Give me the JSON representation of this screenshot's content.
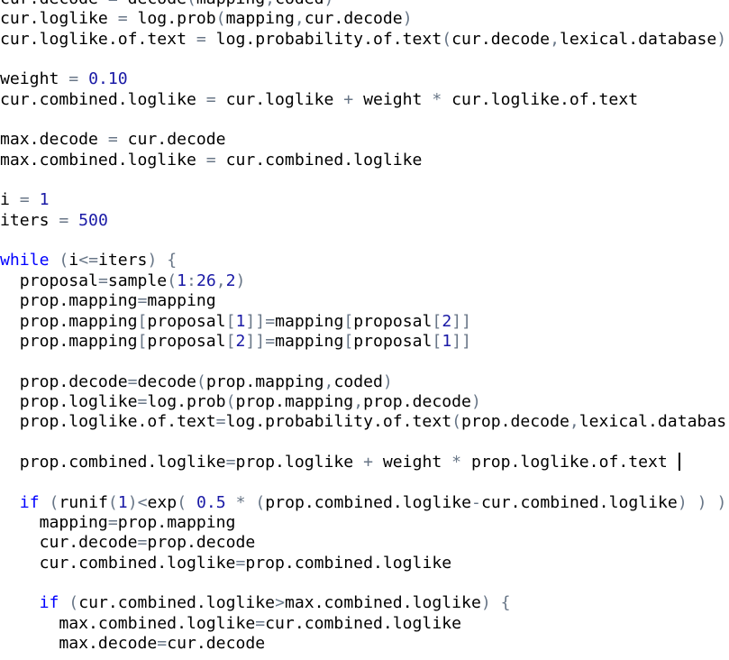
{
  "editor": {
    "cursor_line": 23,
    "lines": [
      [
        {
          "t": "cur.decode",
          "k": "id"
        },
        {
          "t": " = ",
          "k": "op"
        },
        {
          "t": "decode",
          "k": "id"
        },
        {
          "t": "(",
          "k": "br"
        },
        {
          "t": "mapping",
          "k": "id"
        },
        {
          "t": ",",
          "k": "op"
        },
        {
          "t": "coded",
          "k": "id"
        },
        {
          "t": ")",
          "k": "br"
        }
      ],
      [
        {
          "t": "cur.loglike",
          "k": "id"
        },
        {
          "t": " = ",
          "k": "op"
        },
        {
          "t": "log.prob",
          "k": "id"
        },
        {
          "t": "(",
          "k": "br"
        },
        {
          "t": "mapping",
          "k": "id"
        },
        {
          "t": ",",
          "k": "op"
        },
        {
          "t": "cur.decode",
          "k": "id"
        },
        {
          "t": ")",
          "k": "br"
        }
      ],
      [
        {
          "t": "cur.loglike.of.text",
          "k": "id"
        },
        {
          "t": " = ",
          "k": "op"
        },
        {
          "t": "log.probability.of.text",
          "k": "id"
        },
        {
          "t": "(",
          "k": "br"
        },
        {
          "t": "cur.decode",
          "k": "id"
        },
        {
          "t": ",",
          "k": "op"
        },
        {
          "t": "lexical.database",
          "k": "id"
        },
        {
          "t": ")",
          "k": "br"
        }
      ],
      [],
      [
        {
          "t": "weight",
          "k": "id"
        },
        {
          "t": " = ",
          "k": "op"
        },
        {
          "t": "0.10",
          "k": "num"
        }
      ],
      [
        {
          "t": "cur.combined.loglike",
          "k": "id"
        },
        {
          "t": " = ",
          "k": "op"
        },
        {
          "t": "cur.loglike",
          "k": "id"
        },
        {
          "t": " + ",
          "k": "op"
        },
        {
          "t": "weight",
          "k": "id"
        },
        {
          "t": " * ",
          "k": "op"
        },
        {
          "t": "cur.loglike.of.text",
          "k": "id"
        }
      ],
      [],
      [
        {
          "t": "max.decode",
          "k": "id"
        },
        {
          "t": " = ",
          "k": "op"
        },
        {
          "t": "cur.decode",
          "k": "id"
        }
      ],
      [
        {
          "t": "max.combined.loglike",
          "k": "id"
        },
        {
          "t": " = ",
          "k": "op"
        },
        {
          "t": "cur.combined.loglike",
          "k": "id"
        }
      ],
      [],
      [
        {
          "t": "i",
          "k": "id"
        },
        {
          "t": " = ",
          "k": "op"
        },
        {
          "t": "1",
          "k": "num"
        }
      ],
      [
        {
          "t": "iters",
          "k": "id"
        },
        {
          "t": " = ",
          "k": "op"
        },
        {
          "t": "500",
          "k": "num"
        }
      ],
      [],
      [
        {
          "t": "while",
          "k": "kw"
        },
        {
          "t": " ",
          "k": "id"
        },
        {
          "t": "(",
          "k": "br"
        },
        {
          "t": "i",
          "k": "id"
        },
        {
          "t": "<=",
          "k": "op"
        },
        {
          "t": "iters",
          "k": "id"
        },
        {
          "t": ")",
          "k": "br"
        },
        {
          "t": " ",
          "k": "id"
        },
        {
          "t": "{",
          "k": "br"
        }
      ],
      [
        {
          "t": "  proposal",
          "k": "id"
        },
        {
          "t": "=",
          "k": "op"
        },
        {
          "t": "sample",
          "k": "id"
        },
        {
          "t": "(",
          "k": "br"
        },
        {
          "t": "1",
          "k": "num"
        },
        {
          "t": ":",
          "k": "op"
        },
        {
          "t": "26",
          "k": "num"
        },
        {
          "t": ",",
          "k": "op"
        },
        {
          "t": "2",
          "k": "num"
        },
        {
          "t": ")",
          "k": "br"
        }
      ],
      [
        {
          "t": "  prop.mapping",
          "k": "id"
        },
        {
          "t": "=",
          "k": "op"
        },
        {
          "t": "mapping",
          "k": "id"
        }
      ],
      [
        {
          "t": "  prop.mapping",
          "k": "id"
        },
        {
          "t": "[",
          "k": "br"
        },
        {
          "t": "proposal",
          "k": "id"
        },
        {
          "t": "[",
          "k": "br"
        },
        {
          "t": "1",
          "k": "num"
        },
        {
          "t": "]]",
          "k": "br"
        },
        {
          "t": "=",
          "k": "op"
        },
        {
          "t": "mapping",
          "k": "id"
        },
        {
          "t": "[",
          "k": "br"
        },
        {
          "t": "proposal",
          "k": "id"
        },
        {
          "t": "[",
          "k": "br"
        },
        {
          "t": "2",
          "k": "num"
        },
        {
          "t": "]]",
          "k": "br"
        }
      ],
      [
        {
          "t": "  prop.mapping",
          "k": "id"
        },
        {
          "t": "[",
          "k": "br"
        },
        {
          "t": "proposal",
          "k": "id"
        },
        {
          "t": "[",
          "k": "br"
        },
        {
          "t": "2",
          "k": "num"
        },
        {
          "t": "]]",
          "k": "br"
        },
        {
          "t": "=",
          "k": "op"
        },
        {
          "t": "mapping",
          "k": "id"
        },
        {
          "t": "[",
          "k": "br"
        },
        {
          "t": "proposal",
          "k": "id"
        },
        {
          "t": "[",
          "k": "br"
        },
        {
          "t": "1",
          "k": "num"
        },
        {
          "t": "]]",
          "k": "br"
        }
      ],
      [],
      [
        {
          "t": "  prop.decode",
          "k": "id"
        },
        {
          "t": "=",
          "k": "op"
        },
        {
          "t": "decode",
          "k": "id"
        },
        {
          "t": "(",
          "k": "br"
        },
        {
          "t": "prop.mapping",
          "k": "id"
        },
        {
          "t": ",",
          "k": "op"
        },
        {
          "t": "coded",
          "k": "id"
        },
        {
          "t": ")",
          "k": "br"
        }
      ],
      [
        {
          "t": "  prop.loglike",
          "k": "id"
        },
        {
          "t": "=",
          "k": "op"
        },
        {
          "t": "log.prob",
          "k": "id"
        },
        {
          "t": "(",
          "k": "br"
        },
        {
          "t": "prop.mapping",
          "k": "id"
        },
        {
          "t": ",",
          "k": "op"
        },
        {
          "t": "prop.decode",
          "k": "id"
        },
        {
          "t": ")",
          "k": "br"
        }
      ],
      [
        {
          "t": "  prop.loglike.of.text",
          "k": "id"
        },
        {
          "t": "=",
          "k": "op"
        },
        {
          "t": "log.probability.of.text",
          "k": "id"
        },
        {
          "t": "(",
          "k": "br"
        },
        {
          "t": "prop.decode",
          "k": "id"
        },
        {
          "t": ",",
          "k": "op"
        },
        {
          "t": "lexical.databas",
          "k": "id"
        }
      ],
      [],
      [
        {
          "t": "  prop.combined.loglike",
          "k": "id"
        },
        {
          "t": "=",
          "k": "op"
        },
        {
          "t": "prop.loglike",
          "k": "id"
        },
        {
          "t": " + ",
          "k": "op"
        },
        {
          "t": "weight",
          "k": "id"
        },
        {
          "t": " * ",
          "k": "op"
        },
        {
          "t": "prop.loglike.of.text",
          "k": "id"
        },
        {
          "t": " ",
          "k": "id"
        }
      ],
      [],
      [
        {
          "t": "  ",
          "k": "id"
        },
        {
          "t": "if",
          "k": "kw"
        },
        {
          "t": " ",
          "k": "id"
        },
        {
          "t": "(",
          "k": "br"
        },
        {
          "t": "runif",
          "k": "id"
        },
        {
          "t": "(",
          "k": "br"
        },
        {
          "t": "1",
          "k": "num"
        },
        {
          "t": ")",
          "k": "br"
        },
        {
          "t": "<",
          "k": "op"
        },
        {
          "t": "exp",
          "k": "id"
        },
        {
          "t": "(",
          "k": "br"
        },
        {
          "t": " ",
          "k": "id"
        },
        {
          "t": "0.5",
          "k": "num"
        },
        {
          "t": " * ",
          "k": "op"
        },
        {
          "t": "(",
          "k": "br"
        },
        {
          "t": "prop.combined.loglike",
          "k": "id"
        },
        {
          "t": "-",
          "k": "op"
        },
        {
          "t": "cur.combined.loglike",
          "k": "id"
        },
        {
          "t": ")",
          "k": "br"
        },
        {
          "t": " ",
          "k": "id"
        },
        {
          "t": ")",
          "k": "br"
        },
        {
          "t": " ",
          "k": "id"
        },
        {
          "t": ")",
          "k": "br"
        }
      ],
      [
        {
          "t": "    mapping",
          "k": "id"
        },
        {
          "t": "=",
          "k": "op"
        },
        {
          "t": "prop.mapping",
          "k": "id"
        }
      ],
      [
        {
          "t": "    cur.decode",
          "k": "id"
        },
        {
          "t": "=",
          "k": "op"
        },
        {
          "t": "prop.decode",
          "k": "id"
        }
      ],
      [
        {
          "t": "    cur.combined.loglike",
          "k": "id"
        },
        {
          "t": "=",
          "k": "op"
        },
        {
          "t": "prop.combined.loglike",
          "k": "id"
        }
      ],
      [],
      [
        {
          "t": "    ",
          "k": "id"
        },
        {
          "t": "if",
          "k": "kw"
        },
        {
          "t": " ",
          "k": "id"
        },
        {
          "t": "(",
          "k": "br"
        },
        {
          "t": "cur.combined.loglike",
          "k": "id"
        },
        {
          "t": ">",
          "k": "op"
        },
        {
          "t": "max.combined.loglike",
          "k": "id"
        },
        {
          "t": ")",
          "k": "br"
        },
        {
          "t": " ",
          "k": "id"
        },
        {
          "t": "{",
          "k": "br"
        }
      ],
      [
        {
          "t": "      max.combined.loglike",
          "k": "id"
        },
        {
          "t": "=",
          "k": "op"
        },
        {
          "t": "cur.combined.loglike",
          "k": "id"
        }
      ],
      [
        {
          "t": "      max.decode",
          "k": "id"
        },
        {
          "t": "=",
          "k": "op"
        },
        {
          "t": "cur.decode",
          "k": "id"
        }
      ]
    ]
  }
}
